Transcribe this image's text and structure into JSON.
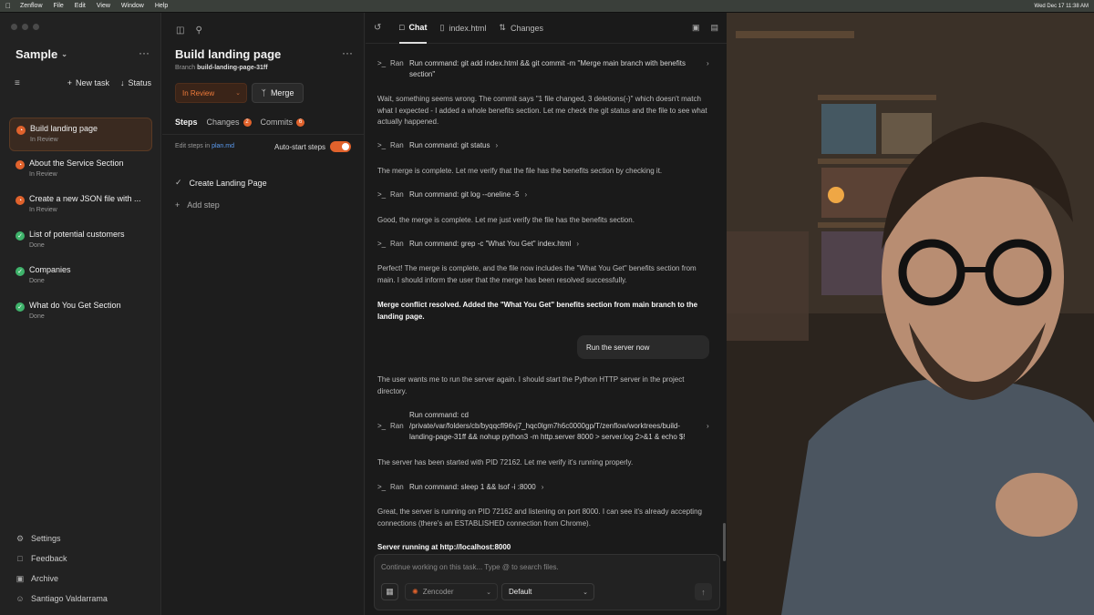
{
  "menubar": {
    "app": "Zenflow",
    "items": [
      "File",
      "Edit",
      "View",
      "Window",
      "Help"
    ],
    "clock": "Wed Dec 17  11:38 AM"
  },
  "sidebar": {
    "workspace": "Sample",
    "new_task": "New task",
    "status": "Status",
    "tasks": [
      {
        "title": "Build landing page",
        "status": "In Review",
        "state": "review",
        "active": true
      },
      {
        "title": "About the Service Section",
        "status": "In Review",
        "state": "review",
        "active": false
      },
      {
        "title": "Create a new JSON file with ...",
        "status": "In Review",
        "state": "review",
        "active": false
      },
      {
        "title": "List of potential customers",
        "status": "Done",
        "state": "done",
        "active": false
      },
      {
        "title": "Companies",
        "status": "Done",
        "state": "done",
        "active": false
      },
      {
        "title": "What do You Get Section",
        "status": "Done",
        "state": "done",
        "active": false
      }
    ],
    "bottom": {
      "settings": "Settings",
      "feedback": "Feedback",
      "archive": "Archive",
      "user": "Santiago Valdarrama"
    }
  },
  "task_panel": {
    "title": "Build landing page",
    "branch_label": "Branch",
    "branch_name": "build-landing-page-31ff",
    "status_button": "In Review",
    "merge_button": "Merge",
    "tabs": {
      "steps": "Steps",
      "changes": "Changes",
      "changes_count": "2",
      "commits": "Commits",
      "commits_count": "6"
    },
    "edit_steps_prefix": "Edit steps in",
    "edit_steps_link": "plan.md",
    "auto_start": "Auto-start steps",
    "steps": [
      "Create Landing Page"
    ],
    "add_step": "Add step"
  },
  "chat": {
    "tabs": {
      "chat": "Chat",
      "file": "index.html",
      "changes": "Changes"
    },
    "ran_label": "Ran",
    "cmd1": "Run command: git add index.html && git commit -m \"Merge main branch with benefits section\"",
    "msg1": "Wait, something seems wrong. The commit says \"1 file changed, 3 deletions(-)\" which doesn't match what I expected - I added a whole benefits section. Let me check the git status and the file to see what actually happened.",
    "cmd2": "Run command: git status",
    "msg2": "The merge is complete. Let me verify that the file has the benefits section by checking it.",
    "cmd3": "Run command: git log --oneline -5",
    "msg3": "Good, the merge is complete. Let me just verify the file has the benefits section.",
    "cmd4": "Run command: grep -c \"What You Get\" index.html",
    "msg4": "Perfect! The merge is complete, and the file now includes the \"What You Get\" benefits section from main. I should inform the user that the merge has been resolved successfully.",
    "msg5": "Merge conflict resolved. Added the \"What You Get\" benefits section from main branch to the landing page.",
    "user_msg": "Run the server now",
    "msg6": "The user wants me to run the server again. I should start the Python HTTP server in the project directory.",
    "cmd5": "Run command: cd /private/var/folders/cb/byqqcfl96vj7_hqc0lgm7h6c0000gp/T/zenflow/worktrees/build-landing-page-31ff && nohup python3 -m http.server 8000 > server.log 2>&1 & echo $!",
    "msg7": "The server has been started with PID 72162. Let me verify it's running properly.",
    "cmd6": "Run command: sleep 1 && lsof -i :8000",
    "msg8": "Great, the server is running on PID 72162 and listening on port 8000. I can see it's already accepting connections (there's an ESTABLISHED connection from Chrome).",
    "msg9": "Server running at http://localhost:8000"
  },
  "composer": {
    "placeholder": "Continue working on this task... Type @ to search files.",
    "agent": "Zencoder",
    "model": "Default"
  },
  "colors": {
    "accent": "#e0622c",
    "done": "#3fb36b",
    "link": "#5b9bf0"
  }
}
